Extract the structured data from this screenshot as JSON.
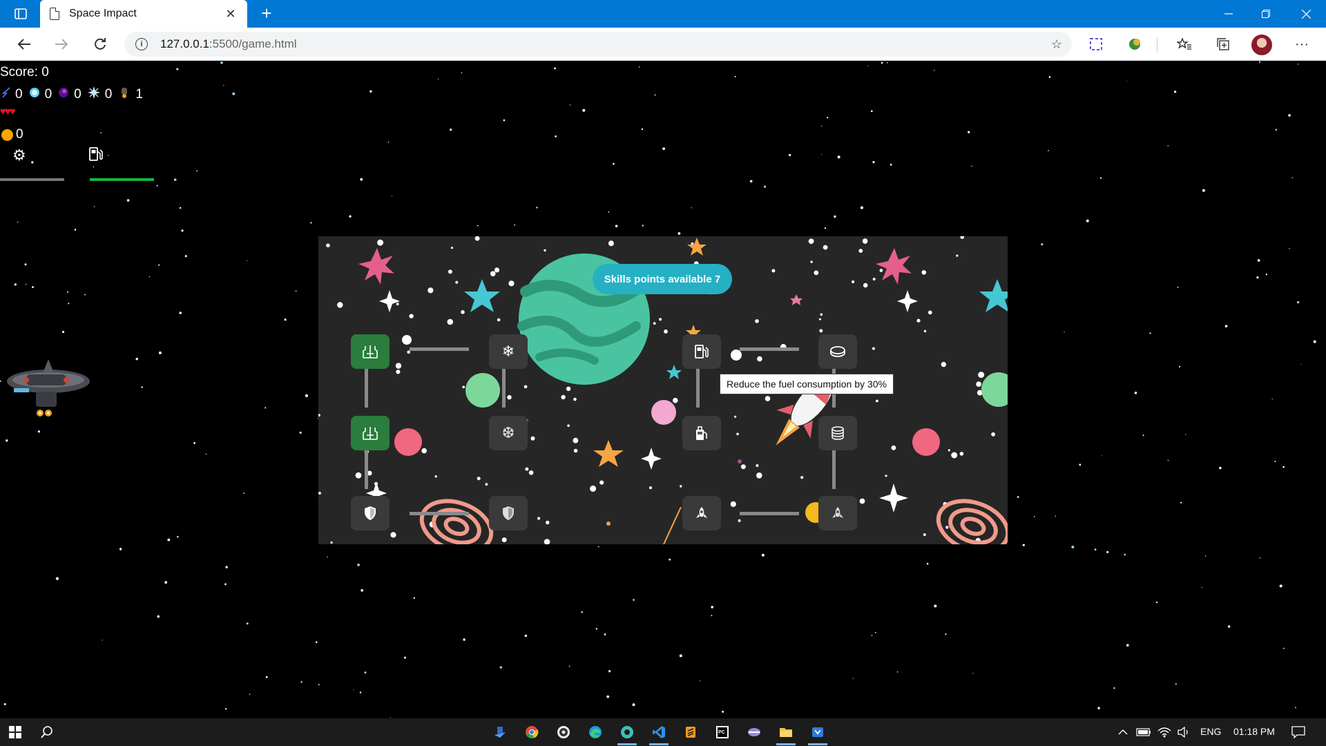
{
  "browser": {
    "tab_title": "Space Impact",
    "tab_close": "✕",
    "new_tab": "+",
    "url_host": "127.0.0.1",
    "url_rest": ":5500/game.html",
    "info": "i"
  },
  "hud": {
    "score_text": "Score: 0",
    "powerups": [
      {
        "icon": "lightning-icon",
        "value": "0"
      },
      {
        "icon": "bubble-shield-icon",
        "value": "0"
      },
      {
        "icon": "purple-orb-icon",
        "value": "0"
      },
      {
        "icon": "freeze-star-icon",
        "value": "0"
      },
      {
        "icon": "ship-icon",
        "value": "1"
      }
    ],
    "lives": "♥♥♥",
    "coins": "0",
    "gear": "⚙",
    "settings_bar_color": "#777777",
    "fuel_bar_color": "#18b53b"
  },
  "skills": {
    "badge_text": "Skills points available 7",
    "tooltip_text": "Reduce the fuel consumption by 30%",
    "nodes": [
      {
        "name": "skill-ship-1",
        "icon": "ship-icon",
        "active": true
      },
      {
        "name": "skill-ship-2",
        "icon": "ship-icon",
        "active": true
      },
      {
        "name": "skill-shield-1",
        "icon": "shield-icon",
        "active": false
      },
      {
        "name": "skill-freeze-1",
        "icon": "snowflake-icon",
        "active": false
      },
      {
        "name": "skill-freeze-2",
        "icon": "snowflake-icon",
        "active": false
      },
      {
        "name": "skill-shield-2",
        "icon": "shield-icon",
        "active": false
      },
      {
        "name": "skill-fuel-1",
        "icon": "fuel-pump-icon",
        "active": false
      },
      {
        "name": "skill-fuel-2",
        "icon": "fuel-pump-icon",
        "active": false
      },
      {
        "name": "skill-rocket-1",
        "icon": "rocket-icon",
        "active": false
      },
      {
        "name": "skill-coin-1",
        "icon": "coin-icon",
        "active": false
      },
      {
        "name": "skill-coin-2",
        "icon": "coin-stack-icon",
        "active": false
      },
      {
        "name": "skill-rocket-2",
        "icon": "rocket-icon",
        "active": false
      }
    ],
    "accent": "#26b0c3",
    "active_node_color": "#2a7d3c"
  },
  "taskbar": {
    "lang": "ENG",
    "time": "01:18 PM"
  }
}
